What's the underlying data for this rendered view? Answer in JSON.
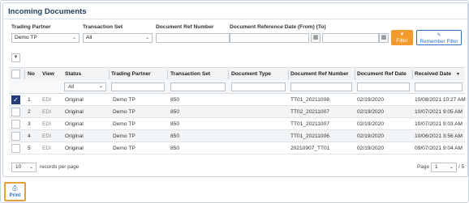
{
  "panel": {
    "title": "Incoming Documents"
  },
  "filters": {
    "trading_partner": {
      "label": "Trading Partner",
      "value": "Demo TP"
    },
    "transaction_set": {
      "label": "Transaction Set",
      "value": "All"
    },
    "doc_ref_number": {
      "label": "Document Ref Number",
      "value": ""
    },
    "doc_ref_date": {
      "label": "Document Reference Date (From) (To)",
      "from": "",
      "to": ""
    },
    "filter_button": "Filter",
    "remember_button": "Remember Filter"
  },
  "table": {
    "columns": {
      "no": "No",
      "view": "View",
      "status": "Status",
      "partner": "Trading Partner",
      "txset": "Transaction Set",
      "doctype": "Document Type",
      "docref": "Document Ref Number",
      "docdate": "Document Ref Date",
      "received": "Received Date"
    },
    "status_filter": "All",
    "rows": [
      {
        "no": "1",
        "view": "EDI",
        "status": "Original",
        "partner": "Demo TP",
        "txset": "850",
        "doctype": "",
        "docref": "TT01_20211008",
        "docdate": "02/19/2020",
        "received": "10/08/2021 10:27 AM",
        "selected": true
      },
      {
        "no": "2",
        "view": "EDI",
        "status": "Original",
        "partner": "Demo TP",
        "txset": "850",
        "doctype": "",
        "docref": "TT02_20211007",
        "docdate": "02/19/2020",
        "received": "10/07/2021 9:05 AM",
        "selected": false
      },
      {
        "no": "3",
        "view": "EDI",
        "status": "Original",
        "partner": "Demo TP",
        "txset": "850",
        "doctype": "",
        "docref": "TT01_20211007",
        "docdate": "02/19/2020",
        "received": "10/07/2021 9:03 AM",
        "selected": false
      },
      {
        "no": "4",
        "view": "EDI",
        "status": "Original",
        "partner": "Demo TP",
        "txset": "850",
        "doctype": "",
        "docref": "TT01_20211006",
        "docdate": "02/19/2020",
        "received": "10/06/2021 3:56 AM",
        "selected": false
      },
      {
        "no": "5",
        "view": "EDI",
        "status": "Original",
        "partner": "Demo TP",
        "txset": "850",
        "doctype": "",
        "docref": "20210907_TT01",
        "docdate": "02/19/2020",
        "received": "09/07/2021 9:04 AM",
        "selected": false
      }
    ]
  },
  "pager": {
    "page_size": "10",
    "records_label": "records per page",
    "page_label": "Page",
    "page": "1",
    "of_pages": "/ 5"
  },
  "print_button": "Print",
  "colors": {
    "accent": "#f29a2e",
    "brand": "#2c70c4",
    "title": "#1f3d5c"
  }
}
